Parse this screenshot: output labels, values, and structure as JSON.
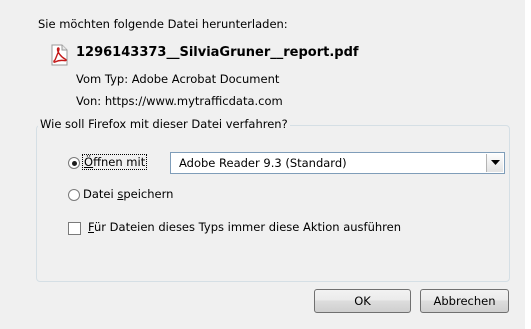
{
  "dialog": {
    "intro_text": "Sie möchten folgende Datei herunterladen:",
    "file": {
      "icon": "pdf-file-icon",
      "name": "1296143373__SilviaGruner__report.pdf",
      "type_label": "Vom Typ:",
      "type_value": "Adobe Acrobat Document",
      "from_label": "Von:",
      "from_value": "https://www.mytrafficdata.com"
    },
    "action_group": {
      "legend": "Wie soll Firefox mit dieser Datei verfahren?",
      "open_with": {
        "label_prefix": "",
        "label_accel": "Ö",
        "label_rest": "ffnen mit",
        "checked": true,
        "application": "Adobe Reader 9.3 (Standard)"
      },
      "save_file": {
        "label_prefix": "Datei ",
        "label_accel": "s",
        "label_rest": "peichern",
        "checked": false
      },
      "always_do": {
        "label_prefix": "",
        "label_accel": "F",
        "label_rest": "ür Dateien dieses Typs immer diese Aktion ausführen",
        "checked": false
      }
    },
    "buttons": {
      "ok": "OK",
      "cancel": "Abbrechen"
    },
    "colors": {
      "background": "#f0f0f0",
      "groupbox_border": "#d5dfe5",
      "pdf_icon": "#c41a1a"
    }
  }
}
